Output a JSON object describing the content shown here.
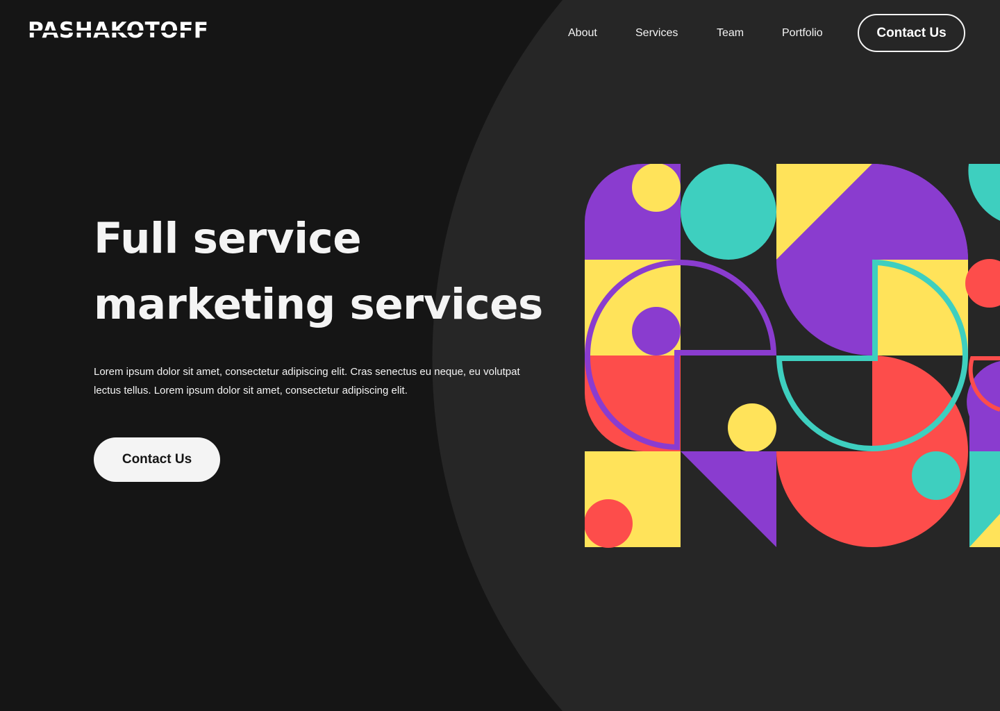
{
  "brand": {
    "logo_text": "PASHAKOTOFF"
  },
  "nav": {
    "links": [
      "About",
      "Services",
      "Team",
      "Portfolio"
    ],
    "cta_label": "Contact Us"
  },
  "hero": {
    "title_line1": "Full service",
    "title_line2": "marketing services",
    "description": "Lorem ipsum dolor sit amet, consectetur adipiscing elit. Cras senectus eu neque, eu volutpat lectus tellus. Lorem ipsum dolor sit amet, consectetur adipiscing elit.",
    "cta_label": "Contact Us"
  },
  "colors": {
    "background": "#151515",
    "background_arc": "#262626",
    "text": "#f4f4f4",
    "purple": "#8a3ccf",
    "yellow": "#ffe35a",
    "teal": "#3ecfbf",
    "red": "#fd4d4b"
  }
}
